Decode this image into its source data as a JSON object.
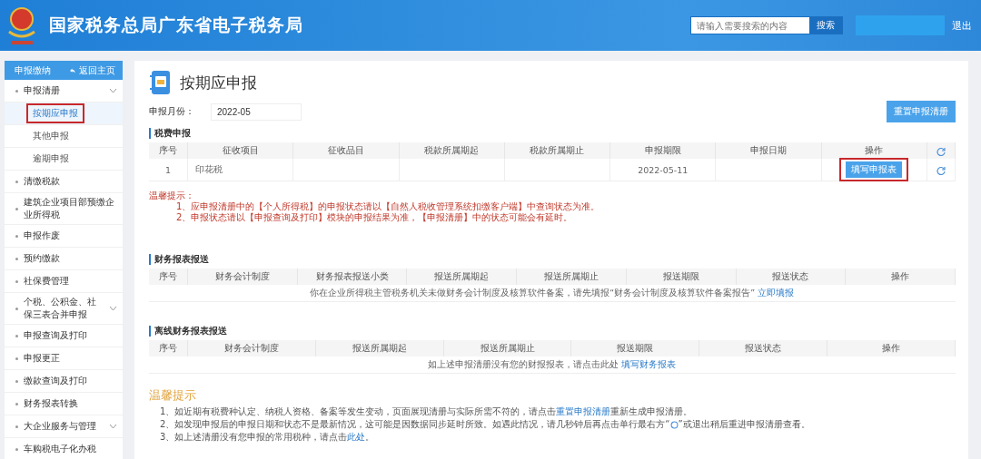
{
  "header": {
    "title": "国家税务总局广东省电子税务局",
    "search": {
      "placeholder": "请输入需要搜索的内容",
      "button": "搜索"
    },
    "logout": "退出"
  },
  "sidebar": {
    "title": "申报缴纳",
    "back": "返回主页",
    "items": [
      {
        "label": "申报清册",
        "expandable": true,
        "children": [
          {
            "label": "按期应申报",
            "selected": true,
            "annotated": true
          },
          {
            "label": "其他申报",
            "selected": false,
            "annotated": false
          },
          {
            "label": "逾期申报",
            "selected": false,
            "annotated": false
          }
        ]
      },
      {
        "label": "清缴税款",
        "expandable": false
      },
      {
        "label": "建筑企业项目部预缴企业所得税",
        "expandable": false
      },
      {
        "label": "申报作废",
        "expandable": false
      },
      {
        "label": "预约缴款",
        "expandable": false
      },
      {
        "label": "社保费管理",
        "expandable": false
      },
      {
        "label": "个税、公积金、社保三表合并申报",
        "expandable": true
      },
      {
        "label": "申报查询及打印",
        "expandable": false
      },
      {
        "label": "申报更正",
        "expandable": false
      },
      {
        "label": "缴款查询及打印",
        "expandable": false
      },
      {
        "label": "财务报表转换",
        "expandable": false
      },
      {
        "label": "大企业服务与管理",
        "expandable": true
      },
      {
        "label": "车购税电子化办税",
        "expandable": false
      }
    ]
  },
  "page": {
    "title": "按期应申报",
    "month_label": "申报月份：",
    "month_value": "2022-05",
    "reset_button": "重置申报清册"
  },
  "tax_section": {
    "title": "税费申报",
    "columns": [
      "序号",
      "征收项目",
      "征收品目",
      "税款所属期起",
      "税款所属期止",
      "申报期限",
      "申报日期",
      "操作"
    ],
    "rows": [
      {
        "cells": [
          "1",
          "印花税",
          "",
          "",
          "",
          "2022-05-11",
          ""
        ],
        "action": "填写申报表",
        "action_annotated": true
      }
    ]
  },
  "notice": {
    "title": "温馨提示：",
    "lines": [
      "1、应申报清册中的【个人所得税】的申报状态请以【自然人税收管理系统扣缴客户端】中查询状态为准。",
      "2、申报状态请以【申报查询及打印】模块的申报结果为准，【申报清册】中的状态可能会有延时。"
    ]
  },
  "finance_section": {
    "title": "财务报表报送",
    "columns": [
      "序号",
      "财务会计制度",
      "财务报表报送小类",
      "报送所属期起",
      "报送所属期止",
      "报送期限",
      "报送状态",
      "操作"
    ],
    "message": "你在企业所得税主管税务机关未做财务会计制度及核算软件备案，请先填报“财务会计制度及核算软件备案报告”",
    "link": "立即填报"
  },
  "offline_section": {
    "title": "离线财务报表报送",
    "columns": [
      "序号",
      "财务会计制度",
      "报送所属期起",
      "报送所属期止",
      "报送期限",
      "报送状态",
      "操作"
    ],
    "message": "如上述申报清册没有您的财报报表，请点击此处",
    "link": "填写财务报表"
  },
  "tips": {
    "title": "温馨提示",
    "items": [
      {
        "before": "1、如近期有税费种认定、纳税人资格、备案等发生变动，页面展现清册与实际所需不符的，请点击",
        "link": "重置申报清册",
        "after": "重新生成申报清册。"
      },
      {
        "before": "2、如发现申报后的申报日期和状态不是最新情况，这可能是因数据同步延时所致。如遇此情况，请几秒钟后再点击单行最右方“",
        "icon": true,
        "after": "”或退出稍后重进申报清册查看。"
      },
      {
        "before": "3、如上述清册没有您申报的常用税种，请点击",
        "link": "此处",
        "after": "。"
      }
    ]
  }
}
